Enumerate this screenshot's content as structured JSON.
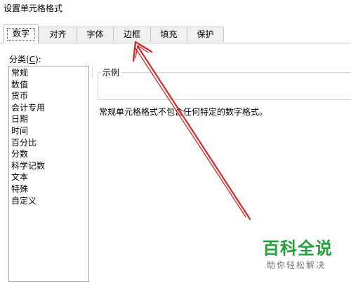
{
  "window": {
    "title": "设置单元格格式"
  },
  "tabs": [
    {
      "label": "数字",
      "active": true
    },
    {
      "label": "对齐",
      "active": false
    },
    {
      "label": "字体",
      "active": false
    },
    {
      "label": "边框",
      "active": false
    },
    {
      "label": "填充",
      "active": false
    },
    {
      "label": "保护",
      "active": false
    }
  ],
  "category": {
    "label_text": "分类(",
    "label_key": "C",
    "label_suffix": "):",
    "items": [
      "常规",
      "数值",
      "货币",
      "会计专用",
      "日期",
      "时间",
      "百分比",
      "分数",
      "科学记数",
      "文本",
      "特殊",
      "自定义"
    ],
    "selected": "常规"
  },
  "sample": {
    "legend": "示例"
  },
  "description": "常规单元格格式不包含任何特定的数字格式。",
  "annotation": {
    "color": "#d42a2a"
  },
  "watermark": {
    "name": "百科全说",
    "slogan": "助你轻松解决",
    "color": "#22a03a"
  }
}
